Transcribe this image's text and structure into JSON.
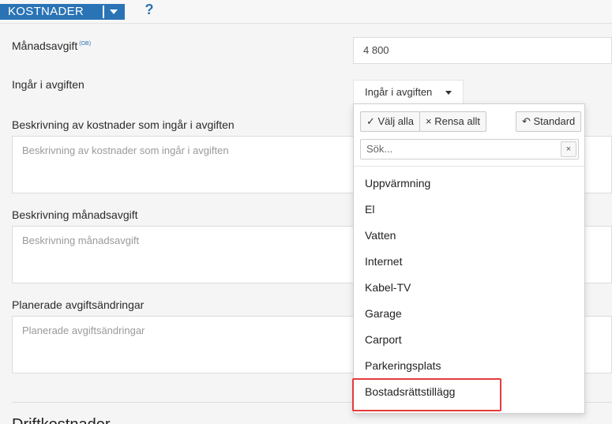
{
  "header": {
    "section_title": "KOSTNADER",
    "help_label": "?"
  },
  "form": {
    "fee": {
      "label": "Månadsavgift",
      "sup": "(OB)",
      "value": "4 800"
    },
    "included": {
      "label": "Ingår i avgiften",
      "trigger_label": "Ingår i avgiften"
    },
    "cost_desc": {
      "label": "Beskrivning av kostnader som ingår i avgiften",
      "placeholder": "Beskrivning av kostnader som ingår i avgiften"
    },
    "fee_desc": {
      "label": "Beskrivning månadsavgift",
      "placeholder": "Beskrivning månadsavgift"
    },
    "planned": {
      "label": "Planerade avgiftsändringar",
      "placeholder": "Planerade avgiftsändringar"
    },
    "next_heading": "Driftkostnader"
  },
  "dropdown": {
    "select_all": "✓ Välj alla",
    "clear_all": "× Rensa allt",
    "standard": "↶ Standard",
    "search_placeholder": "Sök...",
    "search_clear": "×",
    "options": [
      "Uppvärmning",
      "El",
      "Vatten",
      "Internet",
      "Kabel-TV",
      "Garage",
      "Carport",
      "Parkeringsplats",
      "Bostadsrättstillägg"
    ]
  },
  "colors": {
    "accent": "#2a73b5",
    "highlight": "#e53c3c"
  }
}
